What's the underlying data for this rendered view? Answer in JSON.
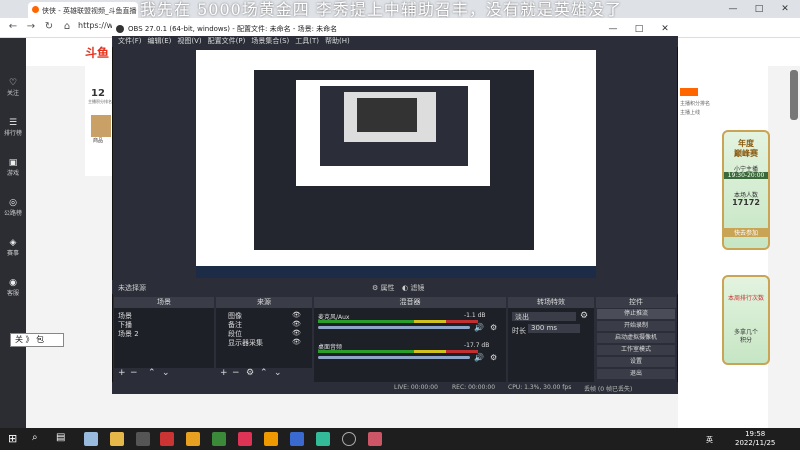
{
  "browser": {
    "tab_title": "侠侠 - 英雄联盟视频_斗鱼直播",
    "url": "https://www",
    "overlay_title": "我先在 5000场黄金四 李秀提上中辅助召丰，没有就是英雄没了"
  },
  "site": {
    "logo": "斗鱼",
    "rank_num": "12",
    "rank_label": "主播积分排名",
    "card_label": "商品",
    "right_head": "主播积分排名",
    "right_sub": "主播上线"
  },
  "sidebar": [
    {
      "label": "关注",
      "icon": "♡"
    },
    {
      "label": "排行榜",
      "icon": "☰"
    },
    {
      "label": "游戏",
      "icon": "▣"
    },
    {
      "label": "公路榜",
      "icon": "◎"
    },
    {
      "label": "赛事",
      "icon": "◈"
    },
    {
      "label": "客服",
      "icon": "◉"
    }
  ],
  "ad": {
    "line1": "年度",
    "line2": "巅峰赛",
    "line3": "小宁主播",
    "line4": "19:30-20:00",
    "line5": "本场人数",
    "line6": "17172",
    "line7": "快去参加"
  },
  "ad2": {
    "line1": "本周排行次数",
    "line2": "多拿几个",
    "line3": "积分"
  },
  "obs": {
    "title": "OBS 27.0.1 (64-bit, windows) - 配置文件: 未命名 - 场景: 未命名",
    "menu": [
      "文件(F)",
      "编辑(E)",
      "视图(V)",
      "配置文件(P)",
      "场景集合(S)",
      "工具(T)",
      "帮助(H)"
    ],
    "scene_label": "未选择源",
    "props": "属性",
    "filters": "滤镜",
    "docks": {
      "scenes": "场景",
      "sources": "来源",
      "mixer": "混音器",
      "transitions": "转场特效",
      "controls": "控件"
    },
    "scenes": [
      "场景",
      "下播",
      "场景 2"
    ],
    "sources": [
      "图像",
      "备注",
      "段位",
      "显示器采集"
    ],
    "mixer": [
      {
        "name": "麦克风/Aux",
        "db": "-1.1 dB"
      },
      {
        "name": "桌面音频",
        "db": "-17.7 dB"
      }
    ],
    "transition": {
      "type": "淡出",
      "duration_label": "时长",
      "duration": "300 ms"
    },
    "controls": [
      "停止推流",
      "开始录制",
      "启动虚拟摄像机",
      "工作室模式",
      "设置",
      "退出"
    ],
    "status": {
      "live": "LIVE: 00:00:00",
      "rec": "REC: 00:00:00",
      "cpu": "CPU: 1.3%, 30.00 fps",
      "dropped": "丢帧 (0 帧已丢失)"
    }
  },
  "widget": {
    "text": "关 》 包"
  },
  "taskbar": {
    "time": "19:58",
    "date": "2022/11/25",
    "lang": "英"
  }
}
